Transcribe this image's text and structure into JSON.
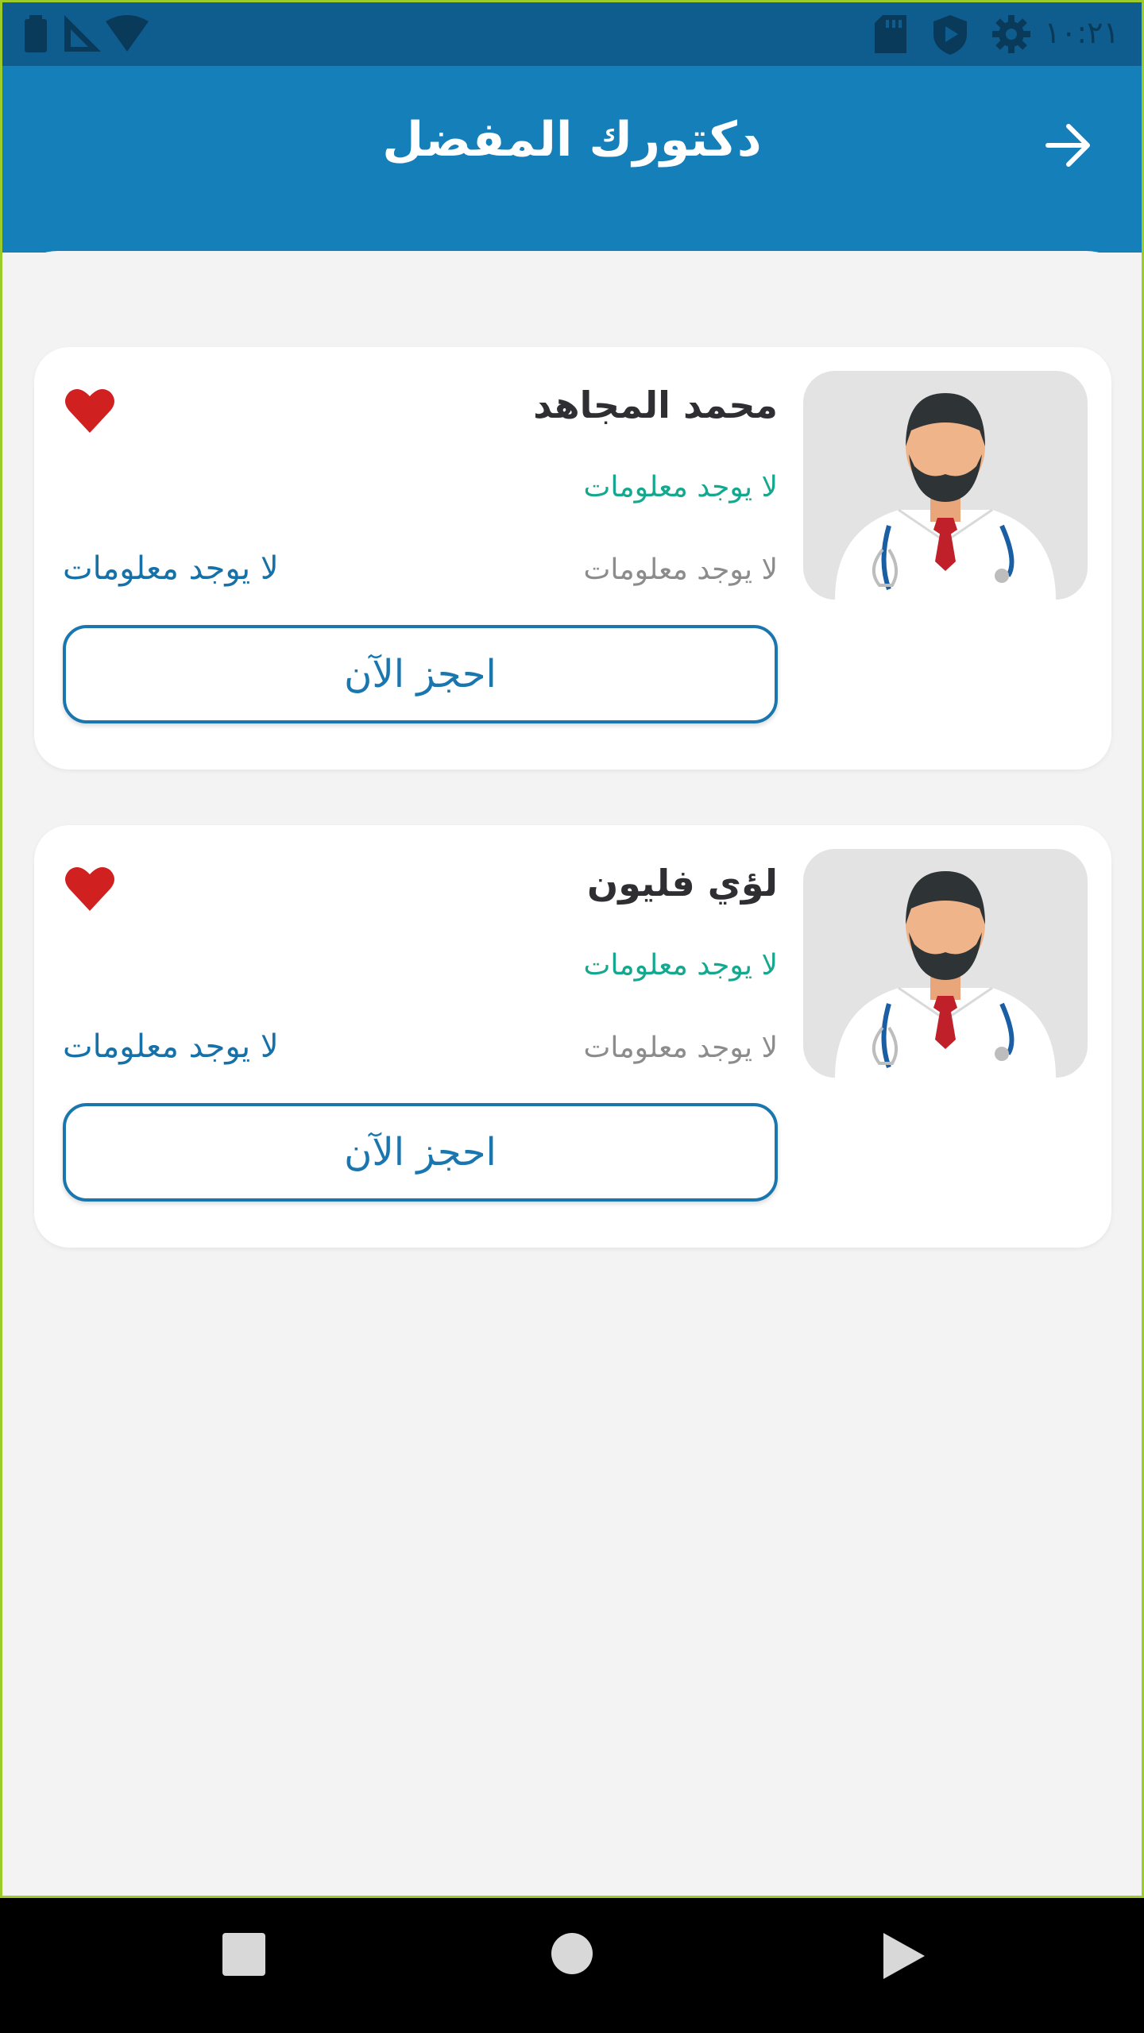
{
  "status_bar": {
    "time": "١٠:٢١",
    "icons": [
      "battery-icon",
      "signal-icon",
      "wifi-icon",
      "sd-card-icon",
      "shield-play-icon",
      "settings-icon"
    ]
  },
  "app_bar": {
    "title": "دكتورك المفضل",
    "back_icon": "arrow-right-icon"
  },
  "doctors": [
    {
      "name": "محمد المجاهد",
      "specialty": "لا يوجد معلومات",
      "info_right": "لا يوجد معلومات",
      "info_left": "لا يوجد معلومات",
      "book_label": "احجز الآن",
      "favorite": true
    },
    {
      "name": "لؤي فليون",
      "specialty": "لا يوجد معلومات",
      "info_right": "لا يوجد معلومات",
      "info_left": "لا يوجد معلومات",
      "book_label": "احجز الآن",
      "favorite": true
    }
  ],
  "nav_bar": {
    "icons": [
      "recents-square-icon",
      "home-circle-icon",
      "back-triangle-icon"
    ]
  },
  "colors": {
    "primary": "#157fba",
    "status_bar": "#0f5d8e",
    "accent_green": "#14a88f",
    "heart_red": "#d0201f",
    "background": "#f3f3f3"
  }
}
